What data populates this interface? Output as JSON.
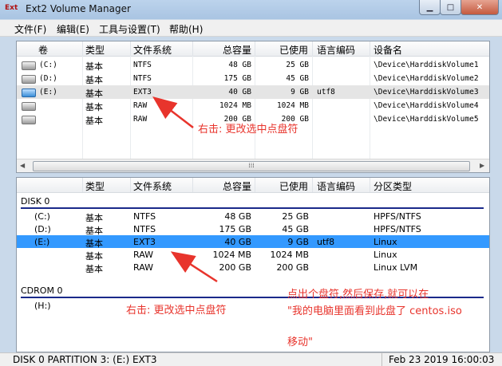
{
  "window": {
    "title": "Ext2 Volume Manager",
    "app_badge": "Ext"
  },
  "menu": [
    "文件(F)",
    "编辑(E)",
    "工具与设置(T)",
    "帮助(H)"
  ],
  "top_table": {
    "columns": [
      "卷",
      "类型",
      "文件系统",
      "总容量",
      "已使用",
      "语言编码",
      "设备名"
    ],
    "rows": [
      {
        "vol": "(C:)",
        "type": "基本",
        "fs": "NTFS",
        "total": "48 GB",
        "used": "25 GB",
        "codepage": "",
        "device": "\\Device\\HarddiskVolume1"
      },
      {
        "vol": "(D:)",
        "type": "基本",
        "fs": "NTFS",
        "total": "175 GB",
        "used": "45 GB",
        "codepage": "",
        "device": "\\Device\\HarddiskVolume2"
      },
      {
        "vol": "(E:)",
        "type": "基本",
        "fs": "EXT3",
        "total": "40 GB",
        "used": "9 GB",
        "codepage": "utf8",
        "device": "\\Device\\HarddiskVolume3"
      },
      {
        "vol": "",
        "type": "基本",
        "fs": "RAW",
        "total": "1024 MB",
        "used": "1024 MB",
        "codepage": "",
        "device": "\\Device\\HarddiskVolume4"
      },
      {
        "vol": "",
        "type": "基本",
        "fs": "RAW",
        "total": "200 GB",
        "used": "200 GB",
        "codepage": "",
        "device": "\\Device\\HarddiskVolume5"
      }
    ]
  },
  "bottom_table": {
    "columns": [
      "类型",
      "文件系统",
      "总容量",
      "已使用",
      "语言编码",
      "分区类型"
    ],
    "disk0_label": "DISK 0",
    "rows": [
      {
        "vol": "(C:)",
        "type": "基本",
        "fs": "NTFS",
        "total": "48 GB",
        "used": "25 GB",
        "codepage": "",
        "ptype": "HPFS/NTFS"
      },
      {
        "vol": "(D:)",
        "type": "基本",
        "fs": "NTFS",
        "total": "175 GB",
        "used": "45 GB",
        "codepage": "",
        "ptype": "HPFS/NTFS"
      },
      {
        "vol": "(E:)",
        "type": "基本",
        "fs": "EXT3",
        "total": "40 GB",
        "used": "9 GB",
        "codepage": "utf8",
        "ptype": "Linux"
      },
      {
        "vol": "",
        "type": "基本",
        "fs": "RAW",
        "total": "1024 MB",
        "used": "1024 MB",
        "codepage": "",
        "ptype": "Linux"
      },
      {
        "vol": "",
        "type": "基本",
        "fs": "RAW",
        "total": "200 GB",
        "used": "200 GB",
        "codepage": "",
        "ptype": "Linux LVM"
      }
    ],
    "cdrom_label": "CDROM 0",
    "cdrom_row": {
      "vol": "(H:)"
    }
  },
  "annotations": {
    "top_note": "右击: 更改选中点盘符",
    "bottom_note": "右击: 更改选中点盘符",
    "save_note_line1": "点出个盘符,然后保存,就可以在",
    "save_note_line2": "\"我的电脑里面看到此盘了 centos.iso",
    "save_note_line3": "移动\"",
    "color": "#e8342c"
  },
  "status": {
    "left": "DISK 0 PARTITION 3: (E:) EXT3",
    "right": "Feb 23 2019 16:00:03"
  }
}
